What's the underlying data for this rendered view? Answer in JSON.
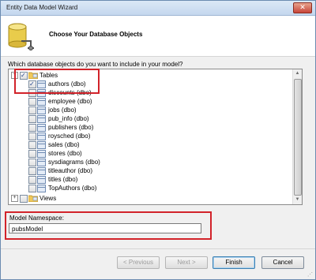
{
  "window": {
    "title": "Entity Data Model Wizard",
    "close_glyph": "✕"
  },
  "header": {
    "title": "Choose Your Database Objects"
  },
  "prompt": "Which database objects do you want to include in your model?",
  "tree": {
    "tables": {
      "label": "Tables",
      "expander": "−",
      "checked": true
    },
    "items": [
      {
        "label": "authors (dbo)",
        "checked": true
      },
      {
        "label": "discounts (dbo)",
        "checked": false
      },
      {
        "label": "employee (dbo)",
        "checked": false
      },
      {
        "label": "jobs (dbo)",
        "checked": false
      },
      {
        "label": "pub_info (dbo)",
        "checked": false
      },
      {
        "label": "publishers (dbo)",
        "checked": false
      },
      {
        "label": "roysched (dbo)",
        "checked": false
      },
      {
        "label": "sales (dbo)",
        "checked": false
      },
      {
        "label": "stores (dbo)",
        "checked": false
      },
      {
        "label": "sysdiagrams (dbo)",
        "checked": false
      },
      {
        "label": "titleauthor (dbo)",
        "checked": false
      },
      {
        "label": "titles (dbo)",
        "checked": false
      },
      {
        "label": "TopAuthors (dbo)",
        "checked": false
      }
    ],
    "views": {
      "label": "Views",
      "expander": "+",
      "checked": false
    }
  },
  "namespace": {
    "label": "Model Namespace:",
    "value": "pubsModel"
  },
  "buttons": {
    "previous": "< Previous",
    "next": "Next >",
    "finish": "Finish",
    "cancel": "Cancel"
  },
  "colors": {
    "highlight": "#d2232a",
    "titlebar": "#c4d7ee"
  }
}
